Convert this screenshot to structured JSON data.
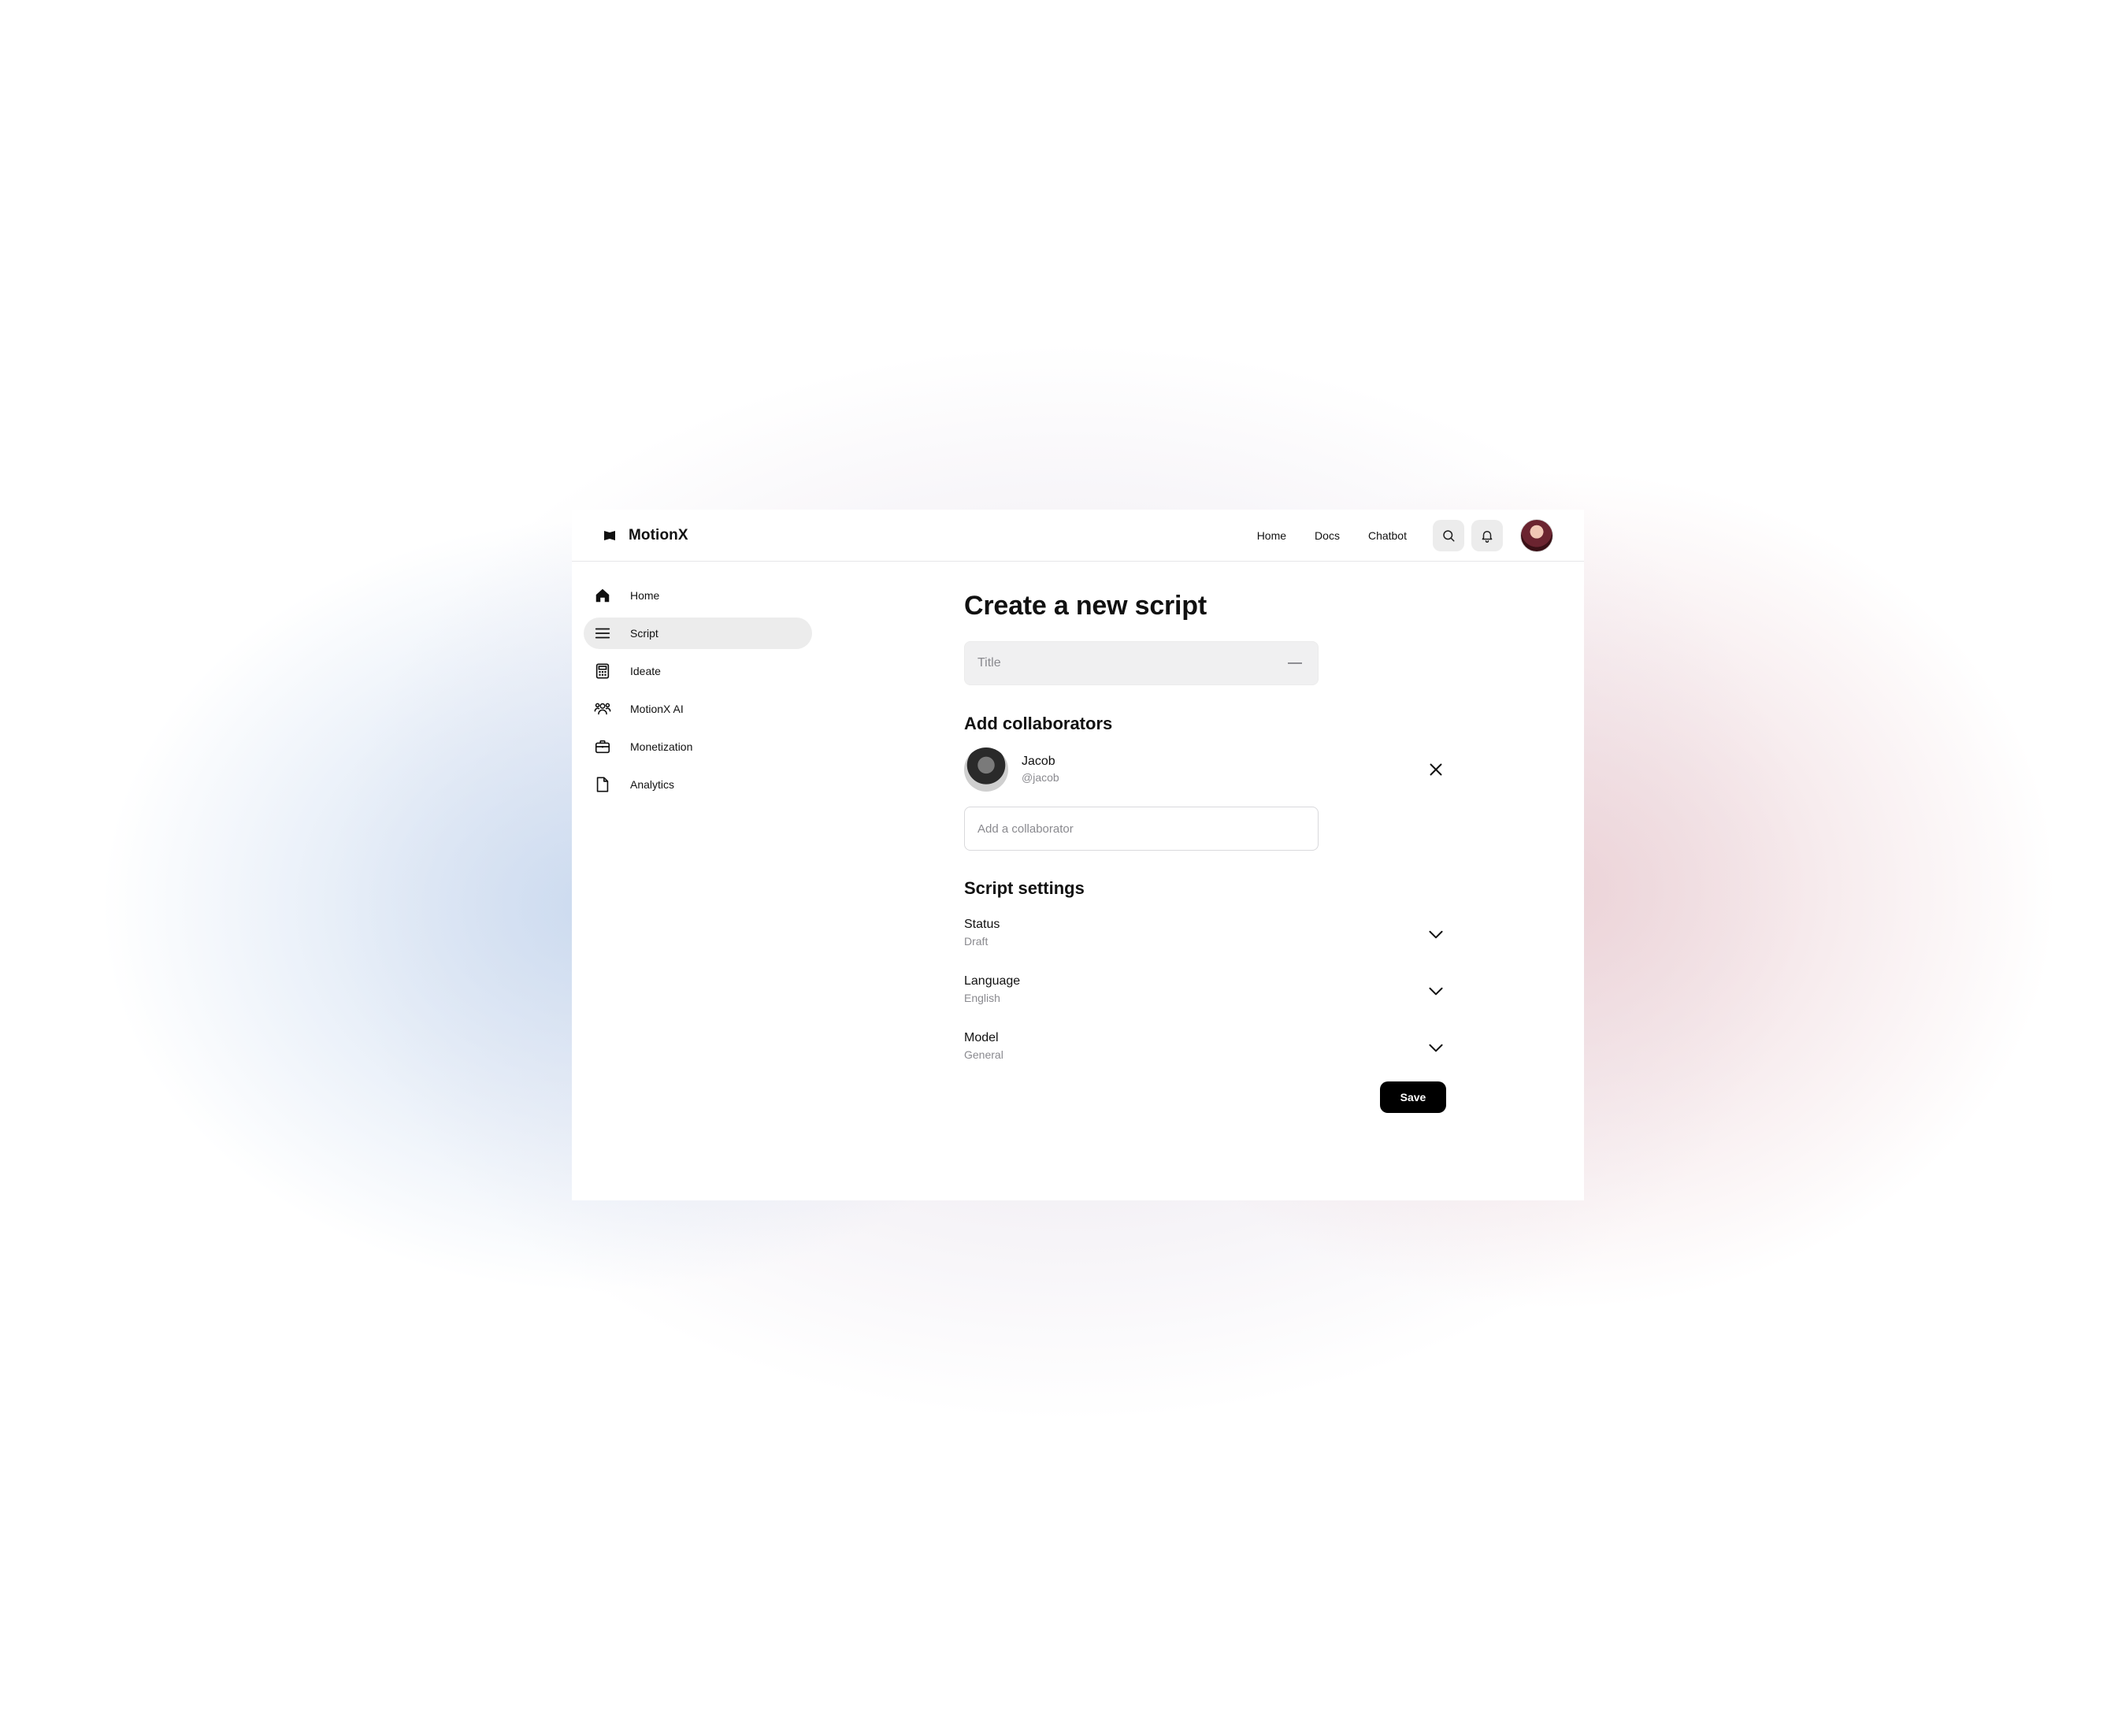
{
  "app": {
    "name": "MotionX"
  },
  "topnav": {
    "links": [
      "Home",
      "Docs",
      "Chatbot"
    ]
  },
  "sidebar": {
    "items": [
      {
        "label": "Home",
        "icon": "home-icon",
        "active": false
      },
      {
        "label": "Script",
        "icon": "menu-icon",
        "active": true
      },
      {
        "label": "Ideate",
        "icon": "calculator-icon",
        "active": false
      },
      {
        "label": "MotionX AI",
        "icon": "users-icon",
        "active": false
      },
      {
        "label": "Monetization",
        "icon": "briefcase-icon",
        "active": false
      },
      {
        "label": "Analytics",
        "icon": "document-icon",
        "active": false
      }
    ]
  },
  "main": {
    "title": "Create a new script",
    "title_field": {
      "placeholder": "Title"
    },
    "collaborators": {
      "heading": "Add collaborators",
      "list": [
        {
          "name": "Jacob",
          "handle": "@jacob"
        }
      ],
      "input_placeholder": "Add a collaborator"
    },
    "settings": {
      "heading": "Script settings",
      "rows": [
        {
          "label": "Status",
          "value": "Draft"
        },
        {
          "label": "Language",
          "value": "English"
        },
        {
          "label": "Model",
          "value": "General"
        }
      ]
    },
    "save_label": "Save"
  }
}
